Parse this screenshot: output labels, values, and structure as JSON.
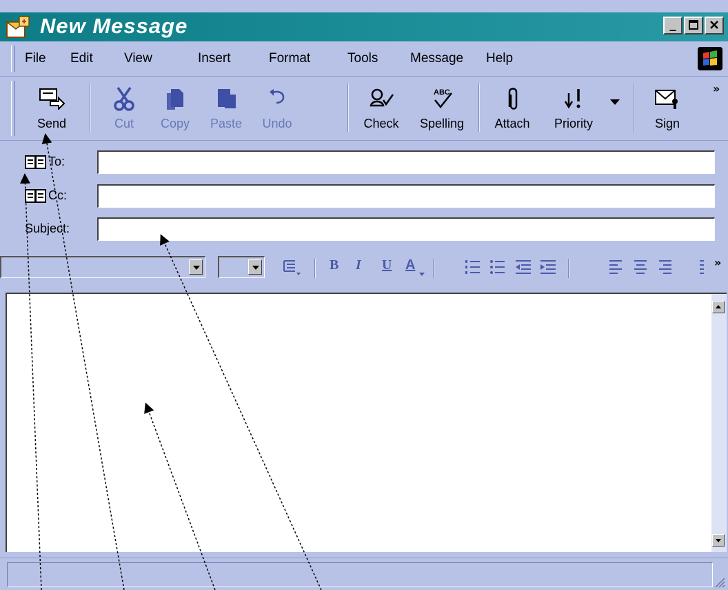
{
  "window": {
    "title": "New Message"
  },
  "menu": {
    "items": [
      "File",
      "Edit",
      "View",
      "Insert",
      "Format",
      "Tools",
      "Message",
      "Help"
    ]
  },
  "toolbar": {
    "buttons": [
      {
        "label": "Send",
        "icon": "send-icon",
        "enabled": true
      },
      {
        "label": "Cut",
        "icon": "scissors-icon",
        "enabled": false
      },
      {
        "label": "Copy",
        "icon": "copy-icon",
        "enabled": false
      },
      {
        "label": "Paste",
        "icon": "paste-icon",
        "enabled": false
      },
      {
        "label": "Undo",
        "icon": "undo-icon",
        "enabled": false
      },
      {
        "label": "Check",
        "icon": "check-names-icon",
        "enabled": true
      },
      {
        "label": "Spelling",
        "icon": "spelling-icon",
        "enabled": true
      },
      {
        "label": "Attach",
        "icon": "paperclip-icon",
        "enabled": true
      },
      {
        "label": "Priority",
        "icon": "priority-icon",
        "enabled": true
      },
      {
        "label": "Sign",
        "icon": "sign-icon",
        "enabled": true
      }
    ],
    "more": "»"
  },
  "header": {
    "to_label": "To:",
    "cc_label": "Cc:",
    "subject_label": "Subject:",
    "to_value": "",
    "cc_value": "",
    "subject_value": ""
  },
  "format": {
    "font_name": "",
    "font_size": "",
    "bold": "B",
    "italic": "I",
    "underline": "U",
    "color": "A",
    "more": "»"
  },
  "body": {
    "text": ""
  },
  "status": {
    "text": ""
  }
}
